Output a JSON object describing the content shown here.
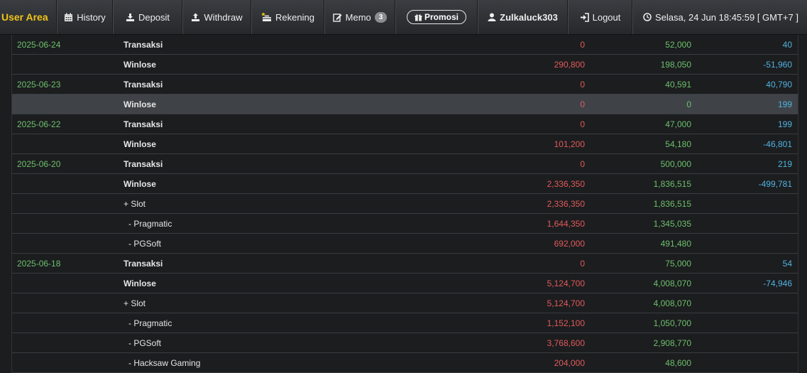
{
  "nav": {
    "brand": "User Area",
    "history": "History",
    "deposit": "Deposit",
    "withdraw": "Withdraw",
    "rekening": "Rekening",
    "memo": "Memo",
    "memo_count": "3",
    "promosi": "Promosi",
    "username": "Zulkaluck303",
    "logout": "Logout",
    "datetime": "Selasa, 24 Jun 18:45:59 [ GMT+7 ]"
  },
  "colors": {
    "brand": "#f0c419",
    "date": "#6cc06c",
    "negative": "#e05a5a",
    "positive": "#6cc06c",
    "balance": "#4fb3e0",
    "highlight_row": "#3f4348"
  },
  "rows": [
    {
      "date": "2025-06-24",
      "type": "Transaksi",
      "debit": "0",
      "credit": "52,000",
      "balance": "40"
    },
    {
      "date": "",
      "type": "Winlose",
      "debit": "290,800",
      "credit": "198,050",
      "balance": "-51,960"
    },
    {
      "date": "2025-06-23",
      "type": "Transaksi",
      "debit": "0",
      "credit": "40,591",
      "balance": "40,790"
    },
    {
      "date": "",
      "type": "Winlose",
      "debit": "0",
      "credit": "0",
      "balance": "199"
    },
    {
      "date": "2025-06-22",
      "type": "Transaksi",
      "debit": "0",
      "credit": "47,000",
      "balance": "199"
    },
    {
      "date": "",
      "type": "Winlose",
      "debit": "101,200",
      "credit": "54,180",
      "balance": "-46,801"
    },
    {
      "date": "2025-06-20",
      "type": "Transaksi",
      "debit": "0",
      "credit": "500,000",
      "balance": "219"
    },
    {
      "date": "",
      "type": "Winlose",
      "debit": "2,336,350",
      "credit": "1,836,515",
      "balance": "-499,781"
    },
    {
      "date": "",
      "type": "+ Slot",
      "debit": "2,336,350",
      "credit": "1,836,515",
      "balance": ""
    },
    {
      "date": "",
      "type": "- Pragmatic",
      "debit": "1,644,350",
      "credit": "1,345,035",
      "balance": ""
    },
    {
      "date": "",
      "type": "- PGSoft",
      "debit": "692,000",
      "credit": "491,480",
      "balance": ""
    },
    {
      "date": "2025-06-18",
      "type": "Transaksi",
      "debit": "0",
      "credit": "75,000",
      "balance": "54"
    },
    {
      "date": "",
      "type": "Winlose",
      "debit": "5,124,700",
      "credit": "4,008,070",
      "balance": "-74,946"
    },
    {
      "date": "",
      "type": "+ Slot",
      "debit": "5,124,700",
      "credit": "4,008,070",
      "balance": ""
    },
    {
      "date": "",
      "type": "- Pragmatic",
      "debit": "1,152,100",
      "credit": "1,050,700",
      "balance": ""
    },
    {
      "date": "",
      "type": "- PGSoft",
      "debit": "3,768,600",
      "credit": "2,908,770",
      "balance": ""
    },
    {
      "date": "",
      "type": "- Hacksaw Gaming",
      "debit": "204,000",
      "credit": "48,600",
      "balance": ""
    }
  ]
}
